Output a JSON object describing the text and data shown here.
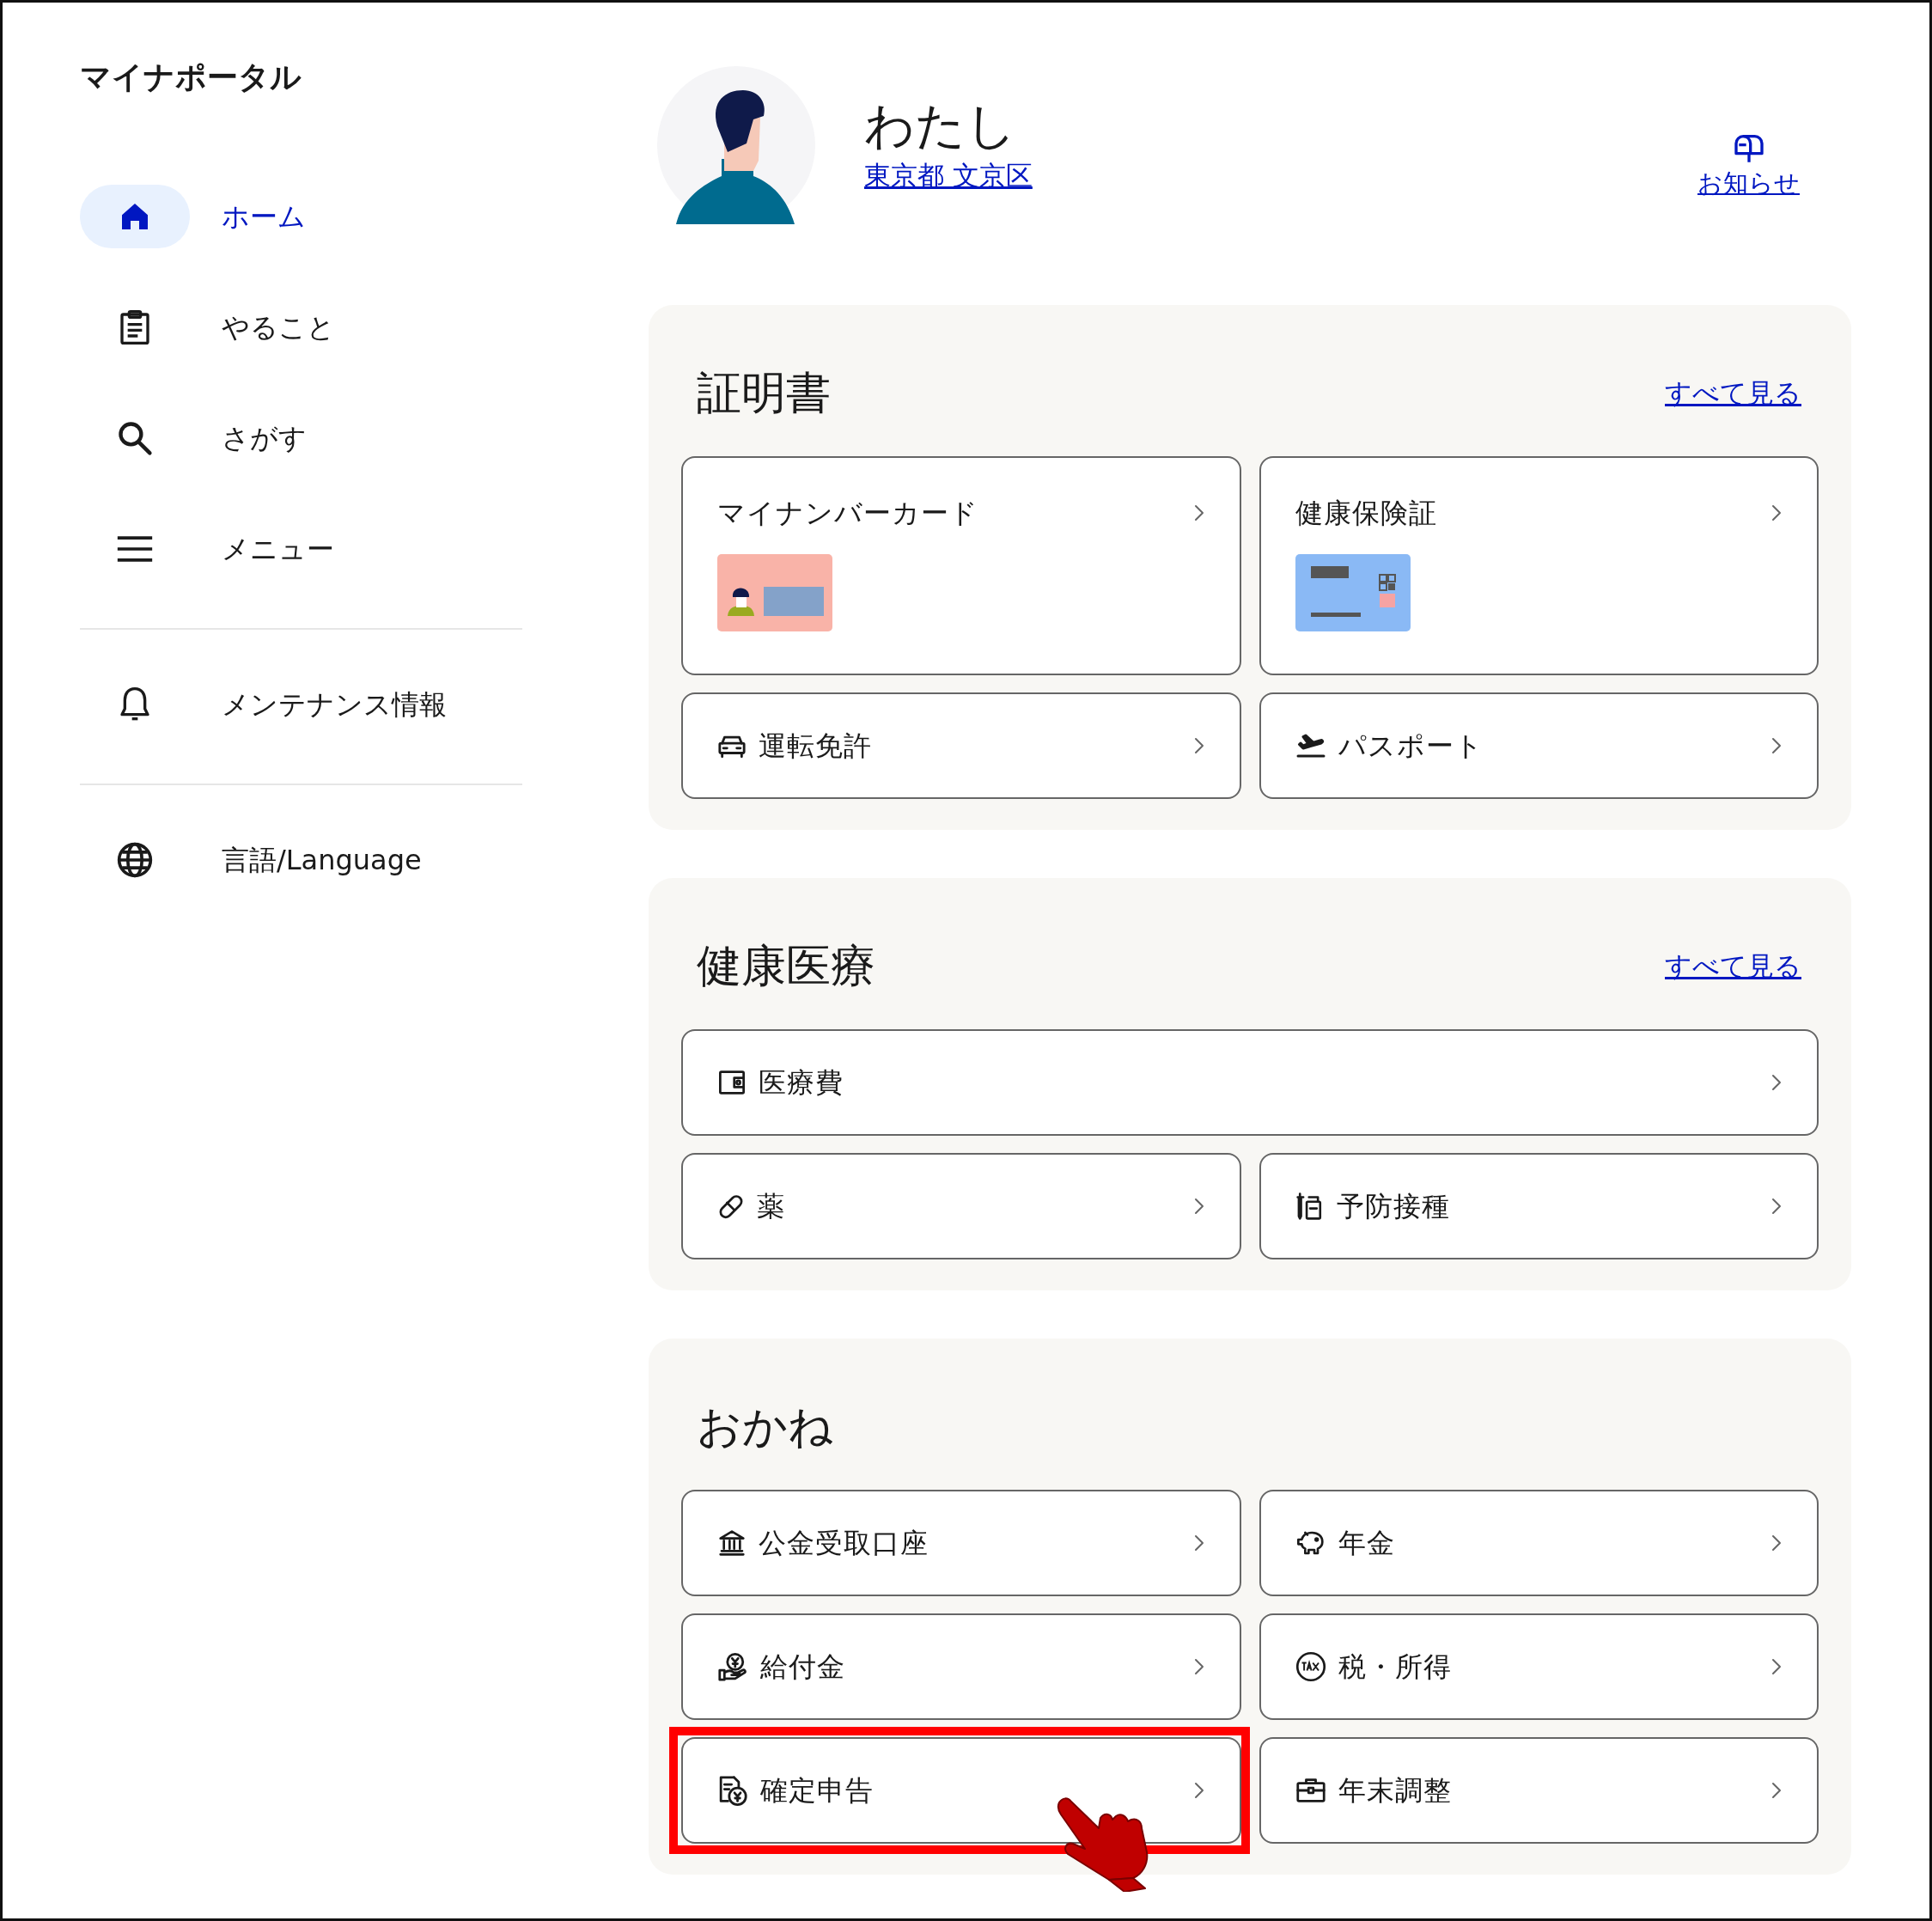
{
  "sidebar": {
    "title": "マイナポータル",
    "groups": [
      {
        "items": [
          {
            "label": "ホーム",
            "selected": true
          },
          {
            "label": "やること",
            "selected": false
          },
          {
            "label": "さがす",
            "selected": false
          },
          {
            "label": "メニュー",
            "selected": false
          }
        ]
      },
      {
        "items": [
          {
            "label": "メンテナンス情報",
            "selected": false
          }
        ]
      },
      {
        "items": [
          {
            "label": "言語/Language",
            "selected": false
          }
        ]
      }
    ]
  },
  "profile": {
    "name": "わたし",
    "location": "東京都 文京区"
  },
  "notices": {
    "label": "お知らせ"
  },
  "sections": [
    {
      "title": "証明書",
      "see_all": "すべて見る",
      "cards": [
        {
          "label": "マイナンバーカード",
          "kind": "large",
          "highlighted": false
        },
        {
          "label": "健康保険証",
          "kind": "large",
          "highlighted": false
        },
        {
          "label": "運転免許",
          "kind": "small",
          "highlighted": false
        },
        {
          "label": "パスポート",
          "kind": "small",
          "highlighted": false
        }
      ]
    },
    {
      "title": "健康医療",
      "see_all": "すべて見る",
      "cards": [
        {
          "label": "医療費",
          "kind": "wide",
          "highlighted": false
        },
        {
          "label": "薬",
          "kind": "small",
          "highlighted": false
        },
        {
          "label": "予防接種",
          "kind": "small",
          "highlighted": false
        }
      ]
    },
    {
      "title": "おかね",
      "cards": [
        {
          "label": "公金受取口座",
          "kind": "small",
          "highlighted": false
        },
        {
          "label": "年金",
          "kind": "small",
          "highlighted": false
        },
        {
          "label": "給付金",
          "kind": "small",
          "highlighted": false
        },
        {
          "label": "税・所得",
          "kind": "small",
          "highlighted": false
        },
        {
          "label": "確定申告",
          "kind": "small",
          "highlighted": true
        },
        {
          "label": "年末調整",
          "kind": "small",
          "highlighted": false
        }
      ]
    }
  ]
}
